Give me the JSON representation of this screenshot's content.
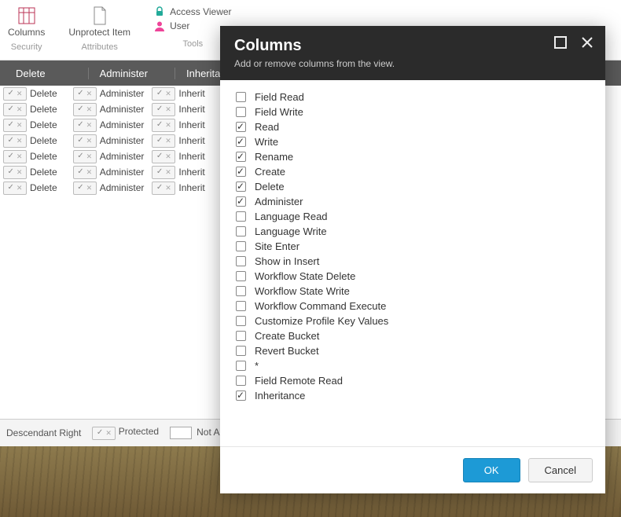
{
  "ribbon": {
    "columns_label": "Columns",
    "columns_group": "Security",
    "unprotect_label": "Unprotect Item",
    "unprotect_group": "Attributes",
    "access_viewer": "Access Viewer",
    "user": "User",
    "tools_group": "Tools"
  },
  "headers": {
    "delete": "Delete",
    "administer": "Administer",
    "inheritance": "Inheritance"
  },
  "row_labels": {
    "delete": "Delete",
    "administer": "Administer",
    "inherit": "Inherit"
  },
  "legend": {
    "descendant": "Descendant Right",
    "protected": "Protected",
    "not_applicable": "Not Applicable"
  },
  "modal": {
    "title": "Columns",
    "subtitle": "Add or remove columns from the view.",
    "ok": "OK",
    "cancel": "Cancel",
    "options": [
      {
        "label": "Field Read",
        "checked": false
      },
      {
        "label": "Field Write",
        "checked": false
      },
      {
        "label": "Read",
        "checked": true
      },
      {
        "label": "Write",
        "checked": true
      },
      {
        "label": "Rename",
        "checked": true
      },
      {
        "label": "Create",
        "checked": true
      },
      {
        "label": "Delete",
        "checked": true
      },
      {
        "label": "Administer",
        "checked": true
      },
      {
        "label": "Language Read",
        "checked": false
      },
      {
        "label": "Language Write",
        "checked": false
      },
      {
        "label": "Site Enter",
        "checked": false
      },
      {
        "label": "Show in Insert",
        "checked": false
      },
      {
        "label": "Workflow State Delete",
        "checked": false
      },
      {
        "label": "Workflow State Write",
        "checked": false
      },
      {
        "label": "Workflow Command Execute",
        "checked": false
      },
      {
        "label": "Customize Profile Key Values",
        "checked": false
      },
      {
        "label": "Create Bucket",
        "checked": false
      },
      {
        "label": "Revert Bucket",
        "checked": false
      },
      {
        "label": "*",
        "checked": false
      },
      {
        "label": "Field Remote Read",
        "checked": false
      },
      {
        "label": "Inheritance",
        "checked": true
      }
    ]
  },
  "grid_row_count": 7
}
